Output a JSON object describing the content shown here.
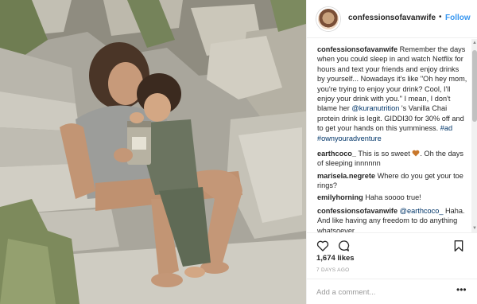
{
  "header": {
    "username": "confessionsofavanwife",
    "separator": "•",
    "follow_label": "Follow"
  },
  "comments": [
    {
      "user": "confessionsofavanwife",
      "text_before_link": " Remember the days when you could sleep in and watch Netflix for hours and text your friends and enjoy drinks by yourself... Nowadays it's like \"Oh hey mom, you're trying to enjoy your drink? Cool, I'll enjoy your drink with you.\" I mean, I don't blame her ",
      "mention": "@kuranutrition",
      "text_after_link": " 's Vanilla Chai protein drink is legit. GIDDI30 for 30% off and to get your hands on this yumminess. ",
      "hashtags": [
        "#ad",
        "#ownyouradventure"
      ]
    },
    {
      "user": "earthcoco_",
      "text_before_heart": " This is so sweet ",
      "text_after_heart": ". Oh the days of sleeping innnnnn"
    },
    {
      "user": "marisela.negrete",
      "text": " Where do you get your toe rings?"
    },
    {
      "user": "emilyhorning",
      "text": " Haha soooo true!"
    },
    {
      "user": "confessionsofavanwife",
      "mention": "@earthcoco_",
      "text": " Haha. And like having any freedom to do anything whatsoever."
    }
  ],
  "icons": {
    "like": "heart-outline-icon",
    "comment": "speech-bubble-icon",
    "save": "bookmark-icon",
    "more": "more-options-icon"
  },
  "likes": "1,674 likes",
  "time": "7 DAYS AGO",
  "add_comment": {
    "placeholder": "Add a comment...",
    "more_label": "•••"
  },
  "colors": {
    "link": "#003569",
    "follow": "#3897f0",
    "heart_emoji": "#c8772c",
    "border": "#efefef"
  }
}
